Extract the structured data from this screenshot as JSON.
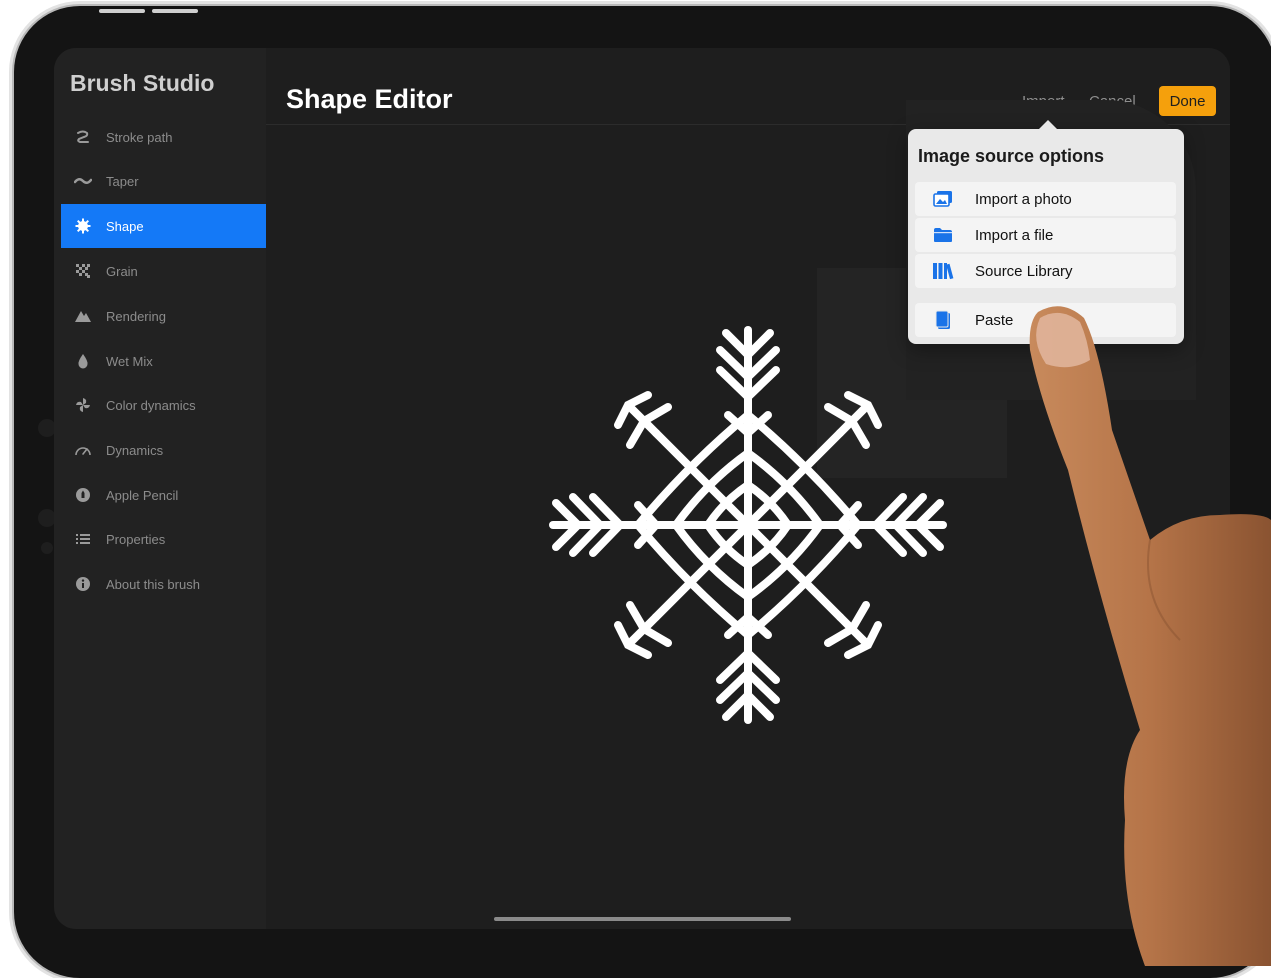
{
  "sidebar": {
    "title": "Brush Studio",
    "items": [
      {
        "label": "Stroke path",
        "icon": "stroke-path-icon"
      },
      {
        "label": "Taper",
        "icon": "taper-icon"
      },
      {
        "label": "Shape",
        "icon": "shape-icon",
        "active": true
      },
      {
        "label": "Grain",
        "icon": "grain-icon"
      },
      {
        "label": "Rendering",
        "icon": "rendering-icon"
      },
      {
        "label": "Wet Mix",
        "icon": "wet-mix-icon"
      },
      {
        "label": "Color dynamics",
        "icon": "color-dynamics-icon"
      },
      {
        "label": "Dynamics",
        "icon": "dynamics-icon"
      },
      {
        "label": "Apple Pencil",
        "icon": "apple-pencil-icon"
      },
      {
        "label": "Properties",
        "icon": "properties-icon"
      },
      {
        "label": "About this brush",
        "icon": "info-icon"
      }
    ]
  },
  "header": {
    "title": "Shape Editor",
    "import_label": "Import",
    "cancel_label": "Cancel",
    "done_label": "Done"
  },
  "popover": {
    "title": "Image source options",
    "options": [
      {
        "label": "Import a photo",
        "icon": "photo-icon"
      },
      {
        "label": "Import a file",
        "icon": "folder-icon"
      },
      {
        "label": "Source Library",
        "icon": "library-icon"
      },
      {
        "label": "Paste",
        "icon": "clipboard-icon"
      }
    ]
  },
  "colors": {
    "accent": "#1479f7",
    "done_button": "#f5a00c",
    "icon_blue": "#1a73e8"
  }
}
